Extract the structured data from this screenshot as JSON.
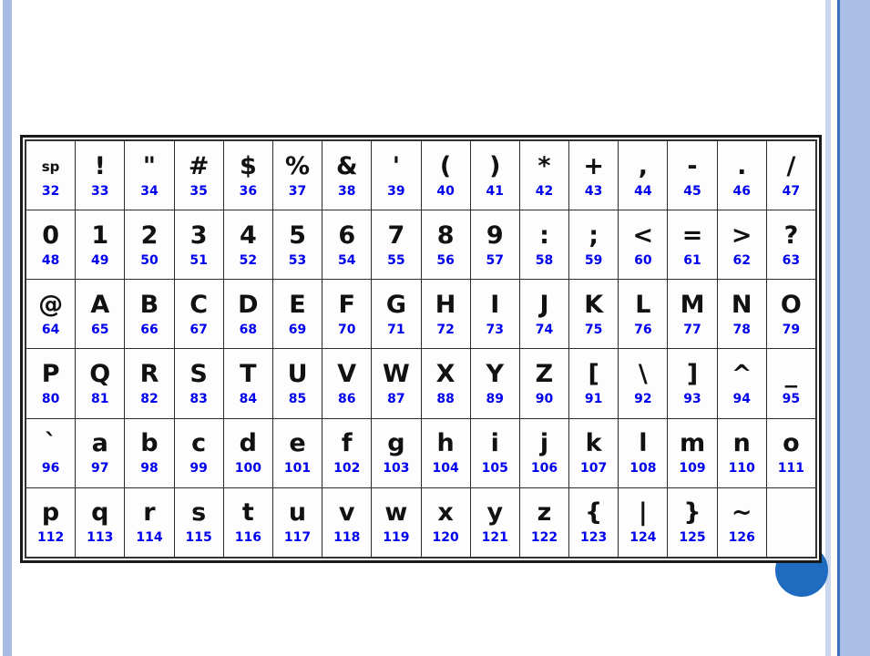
{
  "slide": {
    "background_color": "#ffffff",
    "accent_bar_color": "#a8bce4",
    "accent_rule_color": "#3b6fc4",
    "circle_color": "#1f6bbf",
    "code_color": "#0000ee",
    "glyph_color": "#111111"
  },
  "table": {
    "columns": 16,
    "rows": 6,
    "code_range_start": 32,
    "code_range_end": 127,
    "cells": [
      [
        {
          "glyph": "sp",
          "code": "32",
          "is_label": true
        },
        {
          "glyph": "!",
          "code": "33"
        },
        {
          "glyph": "\"",
          "code": "34"
        },
        {
          "glyph": "#",
          "code": "35"
        },
        {
          "glyph": "$",
          "code": "36"
        },
        {
          "glyph": "%",
          "code": "37"
        },
        {
          "glyph": "&",
          "code": "38"
        },
        {
          "glyph": "'",
          "code": "39"
        },
        {
          "glyph": "(",
          "code": "40"
        },
        {
          "glyph": ")",
          "code": "41"
        },
        {
          "glyph": "*",
          "code": "42"
        },
        {
          "glyph": "+",
          "code": "43"
        },
        {
          "glyph": ",",
          "code": "44"
        },
        {
          "glyph": "-",
          "code": "45"
        },
        {
          "glyph": ".",
          "code": "46"
        },
        {
          "glyph": "/",
          "code": "47"
        }
      ],
      [
        {
          "glyph": "0",
          "code": "48"
        },
        {
          "glyph": "1",
          "code": "49"
        },
        {
          "glyph": "2",
          "code": "50"
        },
        {
          "glyph": "3",
          "code": "51"
        },
        {
          "glyph": "4",
          "code": "52"
        },
        {
          "glyph": "5",
          "code": "53"
        },
        {
          "glyph": "6",
          "code": "54"
        },
        {
          "glyph": "7",
          "code": "55"
        },
        {
          "glyph": "8",
          "code": "56"
        },
        {
          "glyph": "9",
          "code": "57"
        },
        {
          "glyph": ":",
          "code": "58"
        },
        {
          "glyph": ";",
          "code": "59"
        },
        {
          "glyph": "<",
          "code": "60"
        },
        {
          "glyph": "=",
          "code": "61"
        },
        {
          "glyph": ">",
          "code": "62"
        },
        {
          "glyph": "?",
          "code": "63"
        }
      ],
      [
        {
          "glyph": "@",
          "code": "64"
        },
        {
          "glyph": "A",
          "code": "65"
        },
        {
          "glyph": "B",
          "code": "66"
        },
        {
          "glyph": "C",
          "code": "67"
        },
        {
          "glyph": "D",
          "code": "68"
        },
        {
          "glyph": "E",
          "code": "69"
        },
        {
          "glyph": "F",
          "code": "70"
        },
        {
          "glyph": "G",
          "code": "71"
        },
        {
          "glyph": "H",
          "code": "72"
        },
        {
          "glyph": "I",
          "code": "73"
        },
        {
          "glyph": "J",
          "code": "74"
        },
        {
          "glyph": "K",
          "code": "75"
        },
        {
          "glyph": "L",
          "code": "76"
        },
        {
          "glyph": "M",
          "code": "77"
        },
        {
          "glyph": "N",
          "code": "78"
        },
        {
          "glyph": "O",
          "code": "79"
        }
      ],
      [
        {
          "glyph": "P",
          "code": "80"
        },
        {
          "glyph": "Q",
          "code": "81"
        },
        {
          "glyph": "R",
          "code": "82"
        },
        {
          "glyph": "S",
          "code": "83"
        },
        {
          "glyph": "T",
          "code": "84"
        },
        {
          "glyph": "U",
          "code": "85"
        },
        {
          "glyph": "V",
          "code": "86"
        },
        {
          "glyph": "W",
          "code": "87"
        },
        {
          "glyph": "X",
          "code": "88"
        },
        {
          "glyph": "Y",
          "code": "89"
        },
        {
          "glyph": "Z",
          "code": "90"
        },
        {
          "glyph": "[",
          "code": "91"
        },
        {
          "glyph": "\\",
          "code": "92"
        },
        {
          "glyph": "]",
          "code": "93"
        },
        {
          "glyph": "^",
          "code": "94"
        },
        {
          "glyph": "_",
          "code": "95"
        }
      ],
      [
        {
          "glyph": "`",
          "code": "96"
        },
        {
          "glyph": "a",
          "code": "97"
        },
        {
          "glyph": "b",
          "code": "98"
        },
        {
          "glyph": "c",
          "code": "99"
        },
        {
          "glyph": "d",
          "code": "100"
        },
        {
          "glyph": "e",
          "code": "101"
        },
        {
          "glyph": "f",
          "code": "102"
        },
        {
          "glyph": "g",
          "code": "103"
        },
        {
          "glyph": "h",
          "code": "104"
        },
        {
          "glyph": "i",
          "code": "105"
        },
        {
          "glyph": "j",
          "code": "106"
        },
        {
          "glyph": "k",
          "code": "107"
        },
        {
          "glyph": "l",
          "code": "108"
        },
        {
          "glyph": "m",
          "code": "109"
        },
        {
          "glyph": "n",
          "code": "110"
        },
        {
          "glyph": "o",
          "code": "111"
        }
      ],
      [
        {
          "glyph": "p",
          "code": "112"
        },
        {
          "glyph": "q",
          "code": "113"
        },
        {
          "glyph": "r",
          "code": "114"
        },
        {
          "glyph": "s",
          "code": "115"
        },
        {
          "glyph": "t",
          "code": "116"
        },
        {
          "glyph": "u",
          "code": "117"
        },
        {
          "glyph": "v",
          "code": "118"
        },
        {
          "glyph": "w",
          "code": "119"
        },
        {
          "glyph": "x",
          "code": "120"
        },
        {
          "glyph": "y",
          "code": "121"
        },
        {
          "glyph": "z",
          "code": "122"
        },
        {
          "glyph": "{",
          "code": "123"
        },
        {
          "glyph": "|",
          "code": "124"
        },
        {
          "glyph": "}",
          "code": "125"
        },
        {
          "glyph": "~",
          "code": "126"
        },
        {
          "glyph": "",
          "code": "",
          "empty": true
        }
      ]
    ]
  }
}
